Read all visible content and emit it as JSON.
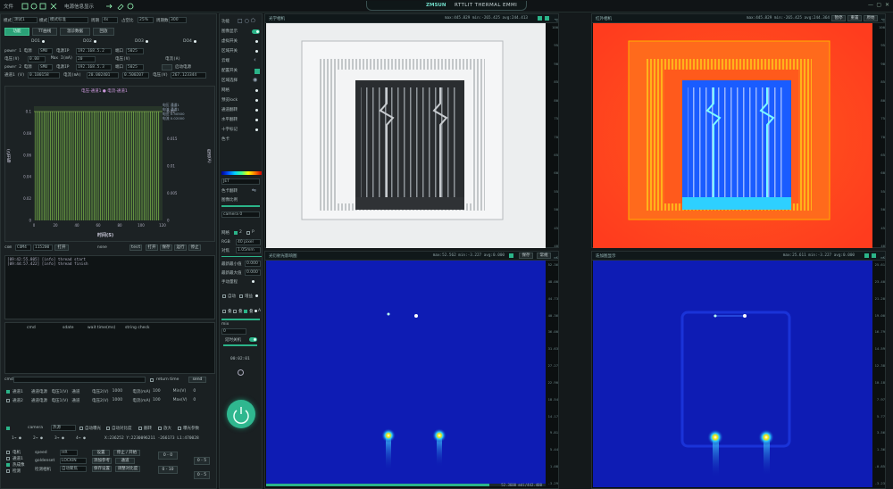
{
  "titlebar": {
    "menu_file": "文件",
    "menu_info": "电源信息显示",
    "app_title": "RTTLIT THERMAL EMMI",
    "brand": "ZMSUN"
  },
  "left": {
    "tabs": [
      "功能",
      "TT曲线",
      "温诊数据",
      "回放"
    ],
    "top_fields": [
      {
        "label": "模式",
        "value": "测试1"
      },
      {
        "label": "模式",
        "value": "模式标准"
      },
      {
        "label": "周期",
        "value": "4s"
      },
      {
        "label": "占空比",
        "value": "25%"
      },
      {
        "label": "周期数",
        "value": "300"
      }
    ],
    "dev_labels": [
      "DO1",
      "DO2",
      "DO3",
      "DO4"
    ],
    "power_rows": [
      {
        "a": "power 1 电源",
        "b": "SMU",
        "c": "电源IP",
        "d": "192.168.5.2",
        "e": "端口",
        "f": "5025"
      },
      {
        "a": "电压(V)",
        "b": "0.00",
        "c": "Max I(mA)",
        "d": "20",
        "e": "电压(V)",
        "f": "—",
        "g": "电流(A)"
      },
      {
        "a": "power 2 电源",
        "b": "SMU",
        "c": "电源IP",
        "d": "192.168.5.3",
        "e": "端口",
        "f": "5025",
        "g": "启动电源"
      },
      {
        "a": "通道1 (V)",
        "b": "0.100158",
        "c": "电流(mA)",
        "d": "20.002401",
        "e": "0.500207",
        "f": "电压(V)",
        "g": "267.123344"
      }
    ],
    "chart_legend": [
      "电压-通道1",
      "电流-通道1"
    ],
    "chart_side": [
      "电压 通道1",
      "电流 通道1",
      "电压 0.30500",
      "电流 0.02000"
    ],
    "axis_left_label": "电压(V)",
    "axis_right_label": "电流(A)",
    "xlabel": "时间(S)",
    "com_row": {
      "label": "com",
      "port": "COM4",
      "baud": "115200",
      "open": "打开",
      "state": "none",
      "btns": [
        "test",
        "打开",
        "保存",
        "运行",
        "停止"
      ]
    },
    "log_lines": [
      "[09:42:55.805] [info] thread start",
      "[09:44:57.422] [info] thread finish"
    ],
    "table_headers": [
      "cmd",
      "sdate",
      "wait time(ms)",
      "string check"
    ],
    "cmd_label": "cmd",
    "return_time": "return time",
    "send": "send",
    "channel_rows": [
      {
        "name": "通道1",
        "cells": [
          "通道电源",
          "电压1(V)",
          "通道",
          "电压2(V)",
          "1000",
          "电流(mA)",
          "100",
          "Min(V)",
          "0"
        ]
      },
      {
        "name": "通道2",
        "cells": [
          "通道电源",
          "电压1(V)",
          "通道",
          "电压2(V)",
          "1000",
          "电流(mA)",
          "100",
          "Max(V)",
          "0"
        ]
      }
    ],
    "footer": {
      "camera_label": "camera",
      "camera_value": "热源",
      "auto_exposure": "自动曝光",
      "auto_contrast": "自动对比度",
      "flip_v": "翻转",
      "zoom": "放大",
      "params": "曝光参数",
      "stats": [
        "1→ ●",
        "2→ ●",
        "3→ ●",
        "4→ ●"
      ],
      "coords": "X:236252 Y:2230096211 -266173 L1:470028",
      "speed_label": "speed",
      "speed_val": "HR",
      "goldenset_label": "goldenset",
      "goldenset_val": "LOCKIN",
      "mode_label": "检测相机",
      "mode_val": "自动聚焦",
      "actions": [
        "设置",
        "添加参考",
        "保存设置",
        "停止 / 开始",
        "通道",
        "调整对比度",
        "添加参数"
      ],
      "sides": [
        "电机",
        "通道1",
        "热成像",
        "检测"
      ],
      "sv_left": [
        "0 - 0",
        "0 - 10"
      ],
      "sv_right": [
        "0 - 5",
        "0 - 5"
      ]
    }
  },
  "mid": {
    "items": [
      {
        "label": "功能",
        "control": "none"
      },
      {
        "label": "图像显示",
        "control": "toggle-on"
      },
      {
        "label": "虚拟开关",
        "control": "dot"
      },
      {
        "label": "区域开关",
        "control": "dot"
      },
      {
        "label": "云端",
        "control": "chevron"
      },
      {
        "label": "配置开关",
        "control": "check"
      },
      {
        "label": "区域选择",
        "control": "eye"
      },
      {
        "label": "网格",
        "control": "dot"
      },
      {
        "label": "预览lock",
        "control": "dot"
      },
      {
        "label": "通道翻转",
        "control": "dot"
      },
      {
        "label": "水平翻转",
        "control": "dot"
      },
      {
        "label": "十字标记",
        "control": "dot"
      },
      {
        "label": "色卡",
        "control": "none"
      }
    ],
    "colormap": "JET",
    "colormap_flip": "色卡翻转",
    "ratio_label": "图像比例",
    "camera_select": "camera 0",
    "grid_label": "网格",
    "grid_opts": [
      "2",
      "P"
    ],
    "rgb_label": "RGB",
    "rgb_value": "40 pixel",
    "focus_label": "对焦",
    "focus_value": "1.05mm",
    "min_scale": "最新最小值",
    "min_val": "0.000",
    "max_scale": "最新最大值",
    "max_val": "0.000",
    "manual": "手动量程",
    "auto": "自动",
    "gain": "增益",
    "row_labels": [
      "叠",
      "叠",
      "叠",
      "A"
    ],
    "mix_label": "mix",
    "mix_val": "0",
    "auto_off_label": "延时关机",
    "timer": "00:02:01",
    "power_button": "power-button"
  },
  "views": [
    {
      "title": "光学相机",
      "stats": "max:445.829 min:-265.425 avg:244.413",
      "btns": [
        "暂停",
        "取样"
      ]
    },
    {
      "title": "红外相机",
      "stats": "max:445.829 min:-265.425 avg:244.364",
      "btns": [
        "暂停",
        "重置",
        "原始"
      ]
    },
    {
      "title": "光衍射光影响图",
      "stats": "max:52.562 min:-3.227 avg:0.000",
      "btns": [
        "保存",
        "常规"
      ]
    },
    {
      "title": "迭加图显示",
      "stats": "max:25.611 min:-3.227 avg:0.000",
      "btns": []
    }
  ],
  "view3_footer": "52.3600 mdi/442.400",
  "scales": {
    "v1": [
      "100",
      "95",
      "90",
      "85",
      "80",
      "75",
      "70",
      "65",
      "60",
      "55",
      "50",
      "45",
      "40"
    ],
    "v2": [
      "100",
      "95",
      "90",
      "85",
      "80",
      "75",
      "70",
      "65",
      "60",
      "55",
      "50",
      "45",
      "40"
    ],
    "v3": [
      "52.36",
      "48.00",
      "44.73",
      "40.36",
      "36.00",
      "31.63",
      "27.27",
      "22.90",
      "18.54",
      "14.17",
      "9.81",
      "5.44",
      "1.08",
      "-3.29"
    ],
    "v4": [
      "25.61",
      "23.40",
      "21.20",
      "19.00",
      "16.79",
      "14.59",
      "12.38",
      "10.18",
      "7.97",
      "5.77",
      "3.56",
      "1.36",
      "-0.85",
      "-3.23"
    ],
    "units": [
      "℃",
      "℃",
      "mK",
      "mK"
    ]
  },
  "colors": {
    "accent": "#2bb489",
    "panel": "#1a2022",
    "bg": "#14191b"
  }
}
